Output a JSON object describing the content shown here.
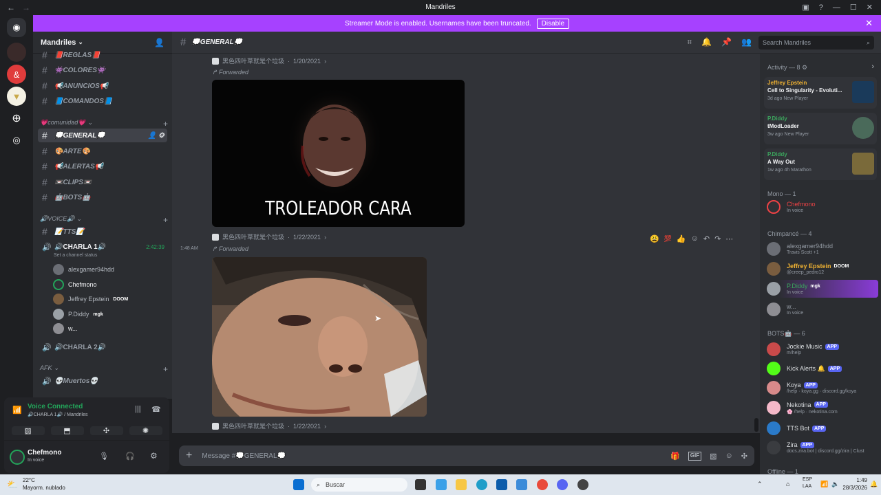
{
  "window": {
    "title": "Mandriles"
  },
  "banner": {
    "text": "Streamer Mode is enabled. Usernames have been truncated.",
    "disable_label": "Disable"
  },
  "server": {
    "name": "Mandriles"
  },
  "channels_top": [
    {
      "name": "📕REGLAS📕"
    },
    {
      "name": "👾COLORES👾"
    },
    {
      "name": "📢ANUNCIOS📢"
    },
    {
      "name": "📘COMANDOS📘"
    }
  ],
  "categories": {
    "comunidad": "💗comunidad💗",
    "voice": "🔊VOICE🔊",
    "afk": "AFK"
  },
  "channels_comunidad": [
    {
      "name": "💭GENERAL💭"
    },
    {
      "name": "🎨ARTE🎨"
    },
    {
      "name": "📢ALERTAS📢"
    },
    {
      "name": "📼CLIPS📼"
    },
    {
      "name": "🤖BOTS🤖"
    }
  ],
  "channels_voice": {
    "tts": "📝TTS📝",
    "charla1": "🔊CHARLA 1🔊",
    "charla1_time": "2:42:39",
    "charla1_status": "Set a channel status",
    "charla2": "🔊CHARLA 2🔊",
    "muertos": "💀Muertos💀"
  },
  "voice_users": [
    {
      "name": "alexgamer94hdd",
      "tag": ""
    },
    {
      "name": "Chefmono",
      "tag": ""
    },
    {
      "name": "Jeffrey Epstein",
      "tag": "DOOM"
    },
    {
      "name": "P.Diddy",
      "tag": "mgk"
    },
    {
      "name": "w...",
      "tag": ""
    }
  ],
  "voice_panel": {
    "status": "Voice Connected",
    "location": "🔊CHARLA 1🔊 / Mandriles"
  },
  "user_panel": {
    "name": "Chefmono",
    "status": "In voice"
  },
  "topbar": {
    "channel": "💭GENERAL💭",
    "search_placeholder": "Search Mandriles"
  },
  "messages": [
    {
      "author": "黑色四叶草就是个垃圾",
      "date": "1/20/2021",
      "forwarded": "Forwarded",
      "caption": "TROLEADOR CARA"
    },
    {
      "author": "黑色四叶草就是个垃圾",
      "date": "1/22/2021",
      "forwarded": "Forwarded",
      "time": "1:48 AM"
    },
    {
      "author": "黑色四叶草就是个垃圾",
      "date": "1/22/2021"
    }
  ],
  "composer": {
    "placeholder": "Message #💭GENERAL💭"
  },
  "members": {
    "activity_header": "Activity — 8",
    "activities": [
      {
        "who": "Jeffrey Epstein",
        "what": "Cell to Singularity - Evoluti...",
        "sub": "3d ago  New Player",
        "color": "#f0b232"
      },
      {
        "who": "P.Diddy",
        "what": "tModLoader",
        "sub": "3w ago  New Player",
        "color": "#3ba55d"
      },
      {
        "who": "P.Diddy",
        "what": "A Way Out",
        "sub": "1w ago  4h Marathon",
        "color": "#3ba55d"
      }
    ],
    "mono_header": "Mono — 1",
    "mono": [
      {
        "name": "Chefmono",
        "status": "In voice",
        "color": "#ed4245"
      }
    ],
    "chimp_header": "Chimpancé — 4",
    "chimp": [
      {
        "name": "alexgamer94hdd",
        "status": "Travis Scott +1",
        "tag": "",
        "color": "#949ba4"
      },
      {
        "name": "Jeffrey Epstein",
        "status": "@creep_pedro12",
        "tag": "DOOM",
        "color": "#f0b232"
      },
      {
        "name": "P.Diddy",
        "status": "In voice",
        "tag": "mgk",
        "color": "#3ba55d"
      },
      {
        "name": "w...",
        "status": "In voice",
        "tag": "",
        "color": "#949ba4"
      }
    ],
    "bots_header": "BOTS🤖 — 6",
    "bots": [
      {
        "name": "Jockie Music",
        "status": "m!help",
        "badge": "APP"
      },
      {
        "name": "Kick Alerts 🔔",
        "status": "",
        "badge": "APP"
      },
      {
        "name": "Koya",
        "status": "/help · koya.gg · discord.gg/koya",
        "badge": "APP"
      },
      {
        "name": "Nekotina",
        "status": "🌸 /help · nekotina.com",
        "badge": "APP"
      },
      {
        "name": "TTS Bot",
        "status": "",
        "badge": "APP"
      },
      {
        "name": "Zira",
        "status": "docs.zira.bot | discord.gg/zira | Clust",
        "badge": "APP"
      }
    ],
    "offline_header": "Offline — 1"
  },
  "taskbar": {
    "weather_temp": "22°C",
    "weather_desc": "Mayorm. nublado",
    "search": "Buscar",
    "lang": "ESP",
    "lang2": "LAA",
    "time": "1:49",
    "date": "28/3/2026"
  }
}
